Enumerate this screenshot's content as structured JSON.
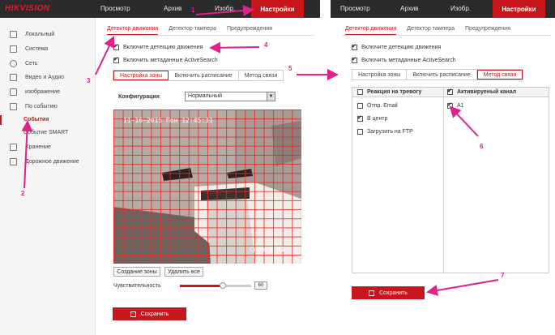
{
  "left": {
    "logo": "HIKVISION",
    "nav": [
      "Просмотр",
      "Архив",
      "Изобр.",
      "Настройки"
    ],
    "sidebar": {
      "items": [
        "Локальный",
        "Система",
        "Сеть",
        "Видео и Аудио",
        "изображение",
        "По событию"
      ],
      "sub": [
        "События",
        "Событие SMART"
      ],
      "items2": [
        "Хранение",
        "Дорожное движение"
      ]
    },
    "tabs": [
      "Детектор движения",
      "Детектор тампера",
      "Предупреждения"
    ],
    "checkboxes": [
      "Включите детекцию движения",
      "Включить метаданные ActiveSearch"
    ],
    "subtabs": [
      "Настройка зоны",
      "Включить расписание",
      "Метод связи"
    ],
    "config_label": "Конфигурация",
    "config_value": "Нормальный",
    "osd_time": "11-16-2015 Пон 12:45:31",
    "osd_camera": "Camera 01",
    "create_zone": "Создание зоны",
    "delete_all": "Удалить все",
    "sensitivity_label": "Чувствительность",
    "sensitivity_value": "60",
    "save": "Сохранить"
  },
  "right": {
    "nav": [
      "Просмотр",
      "Архив",
      "Изобр.",
      "Настройки"
    ],
    "tabs": [
      "Детектор движения",
      "Детектор тампера",
      "Предупреждения"
    ],
    "checkboxes": [
      "Включите детекцию движения",
      "Включить метаданные ActiveSearch"
    ],
    "subtabs": [
      "Настройка зоны",
      "Включить расписание",
      "Метод связи"
    ],
    "col1_header": "Реакция на тревогу",
    "col1_items": [
      "Отпр. Email",
      "В центр",
      "Загрузить на FTP"
    ],
    "col2_header": "Активируеный канал",
    "col2_items": [
      "A1"
    ],
    "save": "Сохранить"
  },
  "annotations": [
    "1",
    "2",
    "3",
    "4",
    "5",
    "6",
    "7"
  ],
  "colors": {
    "accent": "#c8161d",
    "annotation": "#e0218a",
    "topbar": "#2b2b2b"
  }
}
